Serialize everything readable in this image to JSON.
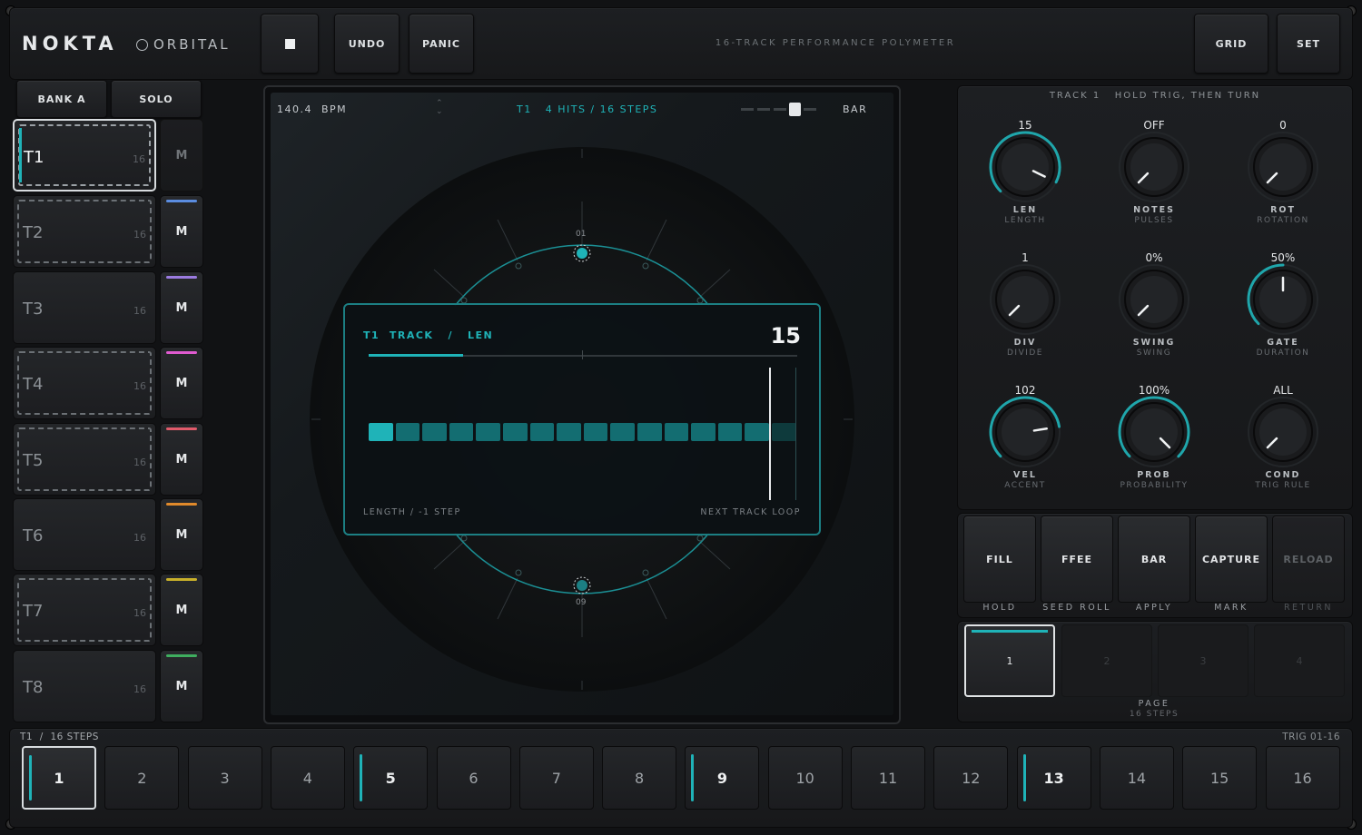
{
  "app": {
    "title": "NOKTA",
    "module": "ORBITAL",
    "subtitle": "16-TRACK PERFORMANCE POLYMETER"
  },
  "toolbar": {
    "stop_icon": "stop-icon",
    "undo": "UNDO",
    "panic": "PANIC",
    "grid": "GRID",
    "set": "SET"
  },
  "bank": {
    "bank": "BANK A",
    "solo": "SOLO"
  },
  "tracks": [
    {
      "name": "T1",
      "steps": "16",
      "mute": "M",
      "color": "#1fb3b8"
    },
    {
      "name": "T2",
      "steps": "16",
      "mute": "M",
      "color": "#5b8de0"
    },
    {
      "name": "T3",
      "steps": "16",
      "mute": "M",
      "color": "#9b7be0"
    },
    {
      "name": "T4",
      "steps": "16",
      "mute": "M",
      "color": "#e05bd0"
    },
    {
      "name": "T5",
      "steps": "16",
      "mute": "M",
      "color": "#e05b6b"
    },
    {
      "name": "T6",
      "steps": "16",
      "mute": "M",
      "color": "#e08a2b"
    },
    {
      "name": "T7",
      "steps": "16",
      "mute": "M",
      "color": "#c8b02a"
    },
    {
      "name": "T8",
      "steps": "16",
      "mute": "M",
      "color": "#3fae5f"
    }
  ],
  "center": {
    "bpm_value": "140.4",
    "bpm_unit": "BPM",
    "track_label": "T1",
    "hits_label": "4 HITS / 16 STEPS",
    "bar_label": "BAR",
    "marker_top": "01",
    "marker_bottom": "09",
    "popup": {
      "track": "T1",
      "section": "TRACK",
      "slash": "/",
      "param": "LEN",
      "value": "15",
      "hint_left": "LENGTH / -1 STEP",
      "hint_right": "NEXT TRACK LOOP",
      "steps_total": 16,
      "steps_active": 15
    }
  },
  "params": {
    "header": "TRACK 1   HOLD TRIG, THEN TURN",
    "knobs": [
      {
        "value": "15",
        "label": "LEN",
        "sub": "LENGTH",
        "level": 0.93
      },
      {
        "value": "OFF",
        "label": "NOTES",
        "sub": "PULSES",
        "level": 0.0
      },
      {
        "value": "0",
        "label": "ROT",
        "sub": "ROTATION",
        "level": 0.0
      },
      {
        "value": "1",
        "label": "DIV",
        "sub": "DIVIDE",
        "level": 0.0
      },
      {
        "value": "0%",
        "label": "SWING",
        "sub": "SWING",
        "level": 0.0
      },
      {
        "value": "50%",
        "label": "GATE",
        "sub": "DURATION",
        "level": 0.5
      },
      {
        "value": "102",
        "label": "VEL",
        "sub": "ACCENT",
        "level": 0.8
      },
      {
        "value": "100%",
        "label": "PROB",
        "sub": "PROBABILITY",
        "level": 1.0
      },
      {
        "value": "ALL",
        "label": "COND",
        "sub": "TRIG RULE",
        "level": 0.0
      }
    ]
  },
  "fx": [
    {
      "label": "FILL",
      "sub": "HOLD"
    },
    {
      "label": "FFEE",
      "sub": "SEED ROLL"
    },
    {
      "label": "BAR",
      "sub": "APPLY"
    },
    {
      "label": "CAPTURE",
      "sub": "MARK"
    },
    {
      "label": "RELOAD",
      "sub": "RETURN"
    }
  ],
  "pages": {
    "items": [
      "1",
      "2",
      "3",
      "4"
    ],
    "label": "PAGE",
    "sub": "16 STEPS"
  },
  "steps_bar": {
    "left_label": "T1  /  16 STEPS",
    "right_label": "TRIG 01-16",
    "steps": [
      "1",
      "2",
      "3",
      "4",
      "5",
      "6",
      "7",
      "8",
      "9",
      "10",
      "11",
      "12",
      "13",
      "14",
      "15",
      "16"
    ],
    "hits": [
      1,
      5,
      9,
      13
    ]
  }
}
